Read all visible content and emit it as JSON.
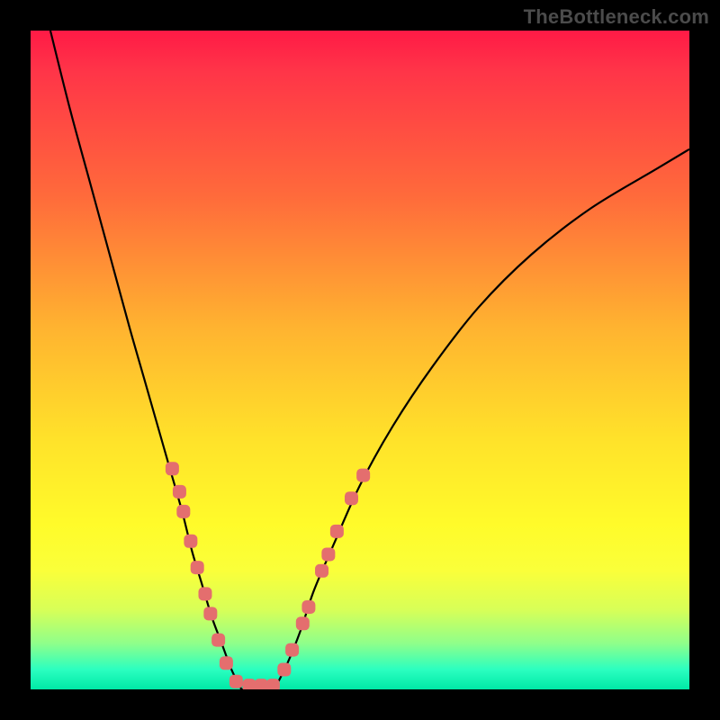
{
  "watermark": "TheBottleneck.com",
  "chart_data": {
    "type": "line",
    "title": "",
    "xlabel": "",
    "ylabel": "",
    "xlim": [
      0,
      100
    ],
    "ylim": [
      0,
      100
    ],
    "grid": false,
    "legend": false,
    "series": [
      {
        "name": "left-curve",
        "x": [
          3,
          6,
          9,
          12,
          15,
          17,
          19,
          21,
          23,
          24.5,
          26,
          27.5,
          29,
          30.5,
          32
        ],
        "y": [
          100,
          88,
          77,
          66,
          55,
          48,
          41,
          34,
          27,
          21,
          16,
          11,
          7,
          3,
          0
        ]
      },
      {
        "name": "right-curve",
        "x": [
          37,
          39,
          41,
          43,
          46,
          50,
          55,
          61,
          68,
          76,
          85,
          95,
          100
        ],
        "y": [
          0,
          4,
          9,
          15,
          22,
          31,
          40,
          49,
          58,
          66,
          73,
          79,
          82
        ]
      },
      {
        "name": "bottom-flat",
        "x": [
          32,
          33.5,
          35,
          36,
          37
        ],
        "y": [
          0,
          0,
          0,
          0,
          0
        ]
      }
    ],
    "markers": {
      "name": "dot-markers",
      "color": "#e46e6e",
      "shape": "rounded-rect",
      "points": [
        {
          "x": 21.5,
          "y": 33.5
        },
        {
          "x": 22.6,
          "y": 30.0
        },
        {
          "x": 23.2,
          "y": 27.0
        },
        {
          "x": 24.3,
          "y": 22.5
        },
        {
          "x": 25.3,
          "y": 18.5
        },
        {
          "x": 26.5,
          "y": 14.5
        },
        {
          "x": 27.3,
          "y": 11.5
        },
        {
          "x": 28.5,
          "y": 7.5
        },
        {
          "x": 29.7,
          "y": 4.0
        },
        {
          "x": 31.2,
          "y": 1.2
        },
        {
          "x": 33.2,
          "y": 0.6
        },
        {
          "x": 35.0,
          "y": 0.6
        },
        {
          "x": 36.8,
          "y": 0.6
        },
        {
          "x": 38.5,
          "y": 3.0
        },
        {
          "x": 39.7,
          "y": 6.0
        },
        {
          "x": 41.3,
          "y": 10.0
        },
        {
          "x": 42.2,
          "y": 12.5
        },
        {
          "x": 44.2,
          "y": 18.0
        },
        {
          "x": 45.2,
          "y": 20.5
        },
        {
          "x": 46.5,
          "y": 24.0
        },
        {
          "x": 48.7,
          "y": 29.0
        },
        {
          "x": 50.5,
          "y": 32.5
        }
      ]
    }
  }
}
